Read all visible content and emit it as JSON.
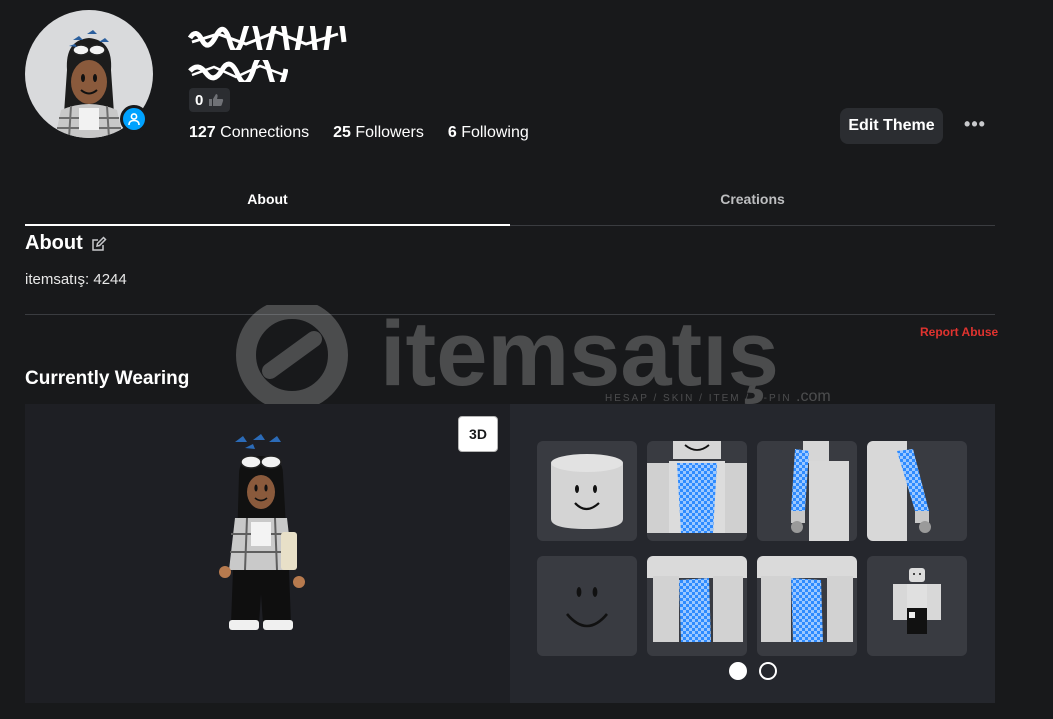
{
  "profile": {
    "likes": "0",
    "connections": {
      "count": "127",
      "label": "Connections"
    },
    "followers": {
      "count": "25",
      "label": "Followers"
    },
    "following": {
      "count": "6",
      "label": "Following"
    },
    "edit_theme_label": "Edit Theme",
    "more_label": "•••"
  },
  "tabs": [
    {
      "label": "About",
      "active": true
    },
    {
      "label": "Creations",
      "active": false
    }
  ],
  "about": {
    "heading": "About",
    "text": "itemsatış: 4244",
    "report_label": "Report Abuse"
  },
  "watermark": {
    "brand": "itemsatış",
    "tagline": "HESAP / SKIN / ITEM / E-PIN",
    "suffix": ".com"
  },
  "wearing": {
    "heading": "Currently Wearing",
    "view_toggle_label": "3D",
    "items": [
      {
        "name": "head-item"
      },
      {
        "name": "shirt-torso-item"
      },
      {
        "name": "right-arm-sleeve-item"
      },
      {
        "name": "left-arm-sleeve-item"
      },
      {
        "name": "smile-face-item"
      },
      {
        "name": "pants-right-leg-item"
      },
      {
        "name": "pants-left-leg-item"
      },
      {
        "name": "outfit-figure-item"
      }
    ],
    "pagination": {
      "pages": 2,
      "current": 1
    }
  },
  "colors": {
    "background": "#18191b",
    "panel": "#25272d",
    "accent_blue": "#00a2ff",
    "report_red": "#e0332f",
    "item_blue": "#2e8bff"
  }
}
